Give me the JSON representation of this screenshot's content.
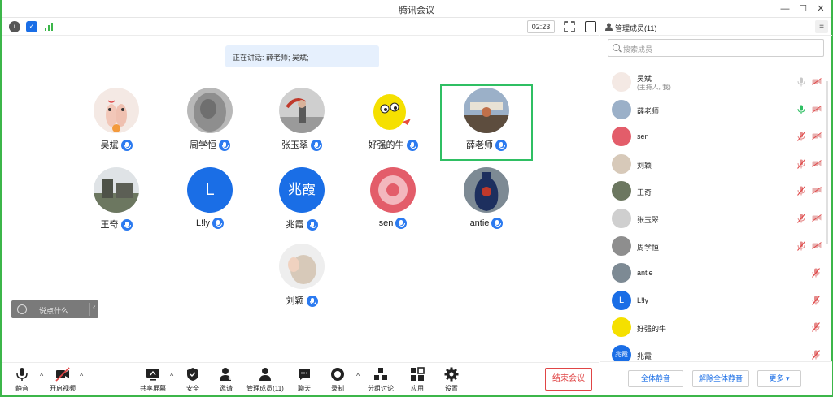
{
  "window": {
    "title": "腾讯会议"
  },
  "topbar": {
    "timer": "02:23"
  },
  "speaking": {
    "text": "正在讲话: 薛老师; 吴斌;"
  },
  "participants": [
    {
      "name": "吴斌",
      "avatar": "photo-fingers"
    },
    {
      "name": "周学恒",
      "avatar": "photo-gray"
    },
    {
      "name": "张玉翠",
      "avatar": "photo-person"
    },
    {
      "name": "好强的牛",
      "avatar": "cartoon-yellow"
    },
    {
      "name": "薛老师",
      "avatar": "photo-landscape",
      "active": true
    },
    {
      "name": "王奇",
      "avatar": "photo-castle"
    },
    {
      "name": "L!ly",
      "avatar": "letter",
      "letter": "L"
    },
    {
      "name": "兆霞",
      "avatar": "letter",
      "letter": "兆霞"
    },
    {
      "name": "sen",
      "avatar": "photo-pattern"
    },
    {
      "name": "antie",
      "avatar": "photo-vase"
    },
    {
      "name": "刘颖",
      "avatar": "photo-hands"
    }
  ],
  "chat": {
    "placeholder": "说点什么..."
  },
  "toolbar": {
    "mute": "静音",
    "video": "开启视频",
    "share": "共享屏幕",
    "security": "安全",
    "invite": "邀请",
    "manage": "管理成员(11)",
    "chat": "聊天",
    "record": "录制",
    "breakout": "分组讨论",
    "apps": "应用",
    "settings": "设置",
    "end": "结束会议"
  },
  "panel": {
    "title": "管理成员(11)",
    "search_placeholder": "搜索成员",
    "members": [
      {
        "name": "吴斌",
        "sub": "(主持人, 我)",
        "mic": "off-gray",
        "cam": "off-gray"
      },
      {
        "name": "薛老师",
        "sub": "",
        "mic": "on-green",
        "cam": "off-gray"
      },
      {
        "name": "sen",
        "sub": "",
        "mic": "muted",
        "cam": "off-gray"
      },
      {
        "name": "刘颖",
        "sub": "",
        "mic": "muted",
        "cam": "off-gray"
      },
      {
        "name": "王奇",
        "sub": "",
        "mic": "muted",
        "cam": "off-gray"
      },
      {
        "name": "张玉翠",
        "sub": "",
        "mic": "muted",
        "cam": "off-gray"
      },
      {
        "name": "周学恒",
        "sub": "",
        "mic": "muted",
        "cam": "off-gray"
      },
      {
        "name": "antie",
        "sub": "",
        "mic": "muted",
        "cam": ""
      },
      {
        "name": "L!ly",
        "sub": "",
        "mic": "muted",
        "cam": ""
      },
      {
        "name": "好强的牛",
        "sub": "",
        "mic": "muted",
        "cam": ""
      },
      {
        "name": "兆霞",
        "sub": "",
        "mic": "muted",
        "cam": ""
      }
    ],
    "mute_all": "全体静音",
    "unmute_all": "解除全体静音",
    "more": "更多 ▾"
  },
  "colors": {
    "accent": "#1a6ee6",
    "active_border": "#2fbf63",
    "end": "#e04545",
    "window_border": "#3cb64a"
  }
}
